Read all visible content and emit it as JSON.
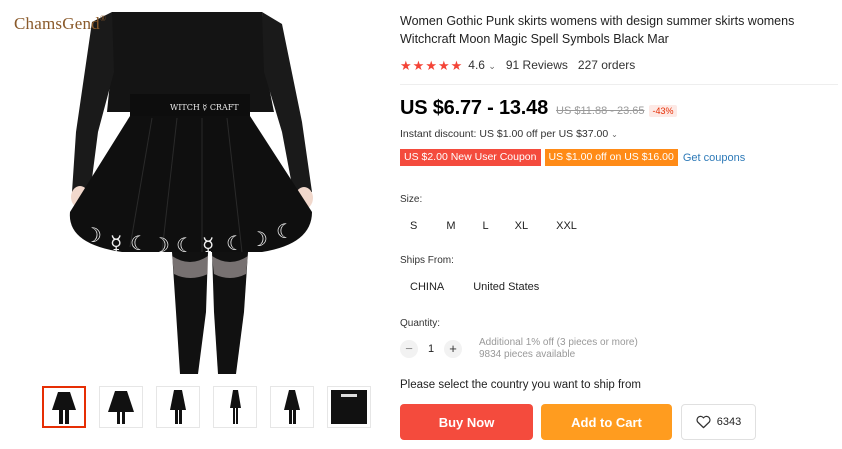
{
  "brand": {
    "name": "ChamsGend",
    "mark": "®"
  },
  "product": {
    "title": "Women Gothic Punk skirts womens with design summer skirts womens Witchcraft Moon Magic Spell Symbols Black Mar",
    "rating": "4.6",
    "stars": 5,
    "reviews": "91 Reviews",
    "orders": "227 orders",
    "price": "US $6.77 - 13.48",
    "old_price": "US $11.88 - 23.65",
    "discount": "-43%",
    "instant_discount": "Instant discount: US $1.00 off per US $37.00"
  },
  "coupons": [
    {
      "label": "US $2.00 New User Coupon",
      "color": "#f44b3d"
    },
    {
      "label": "US $1.00 off on US $16.00",
      "color": "#ff8b17"
    }
  ],
  "get_coupons": "Get coupons",
  "size": {
    "label": "Size:",
    "options": [
      "S",
      "M",
      "L",
      "XL",
      "XXL"
    ]
  },
  "ships_from": {
    "label": "Ships From:",
    "options": [
      "CHINA",
      "United States"
    ]
  },
  "quantity": {
    "label": "Quantity:",
    "value": "1",
    "minus": "−",
    "plus": "+",
    "note_line1": "Additional 1% off (3 pieces or more)",
    "note_line2": "9834 pieces available"
  },
  "ship_message": "Please select the country you want to ship from",
  "buttons": {
    "buy_now": "Buy Now",
    "add_to_cart": "Add to Cart",
    "wishlist_count": "6343"
  },
  "colors": {
    "accent_red": "#f44b3d",
    "accent_orange": "#ff9c1f",
    "link_blue": "#2e7ab8",
    "star": "#f44336"
  },
  "icons": [
    "star-icon",
    "chevron-down-icon",
    "heart-icon"
  ]
}
